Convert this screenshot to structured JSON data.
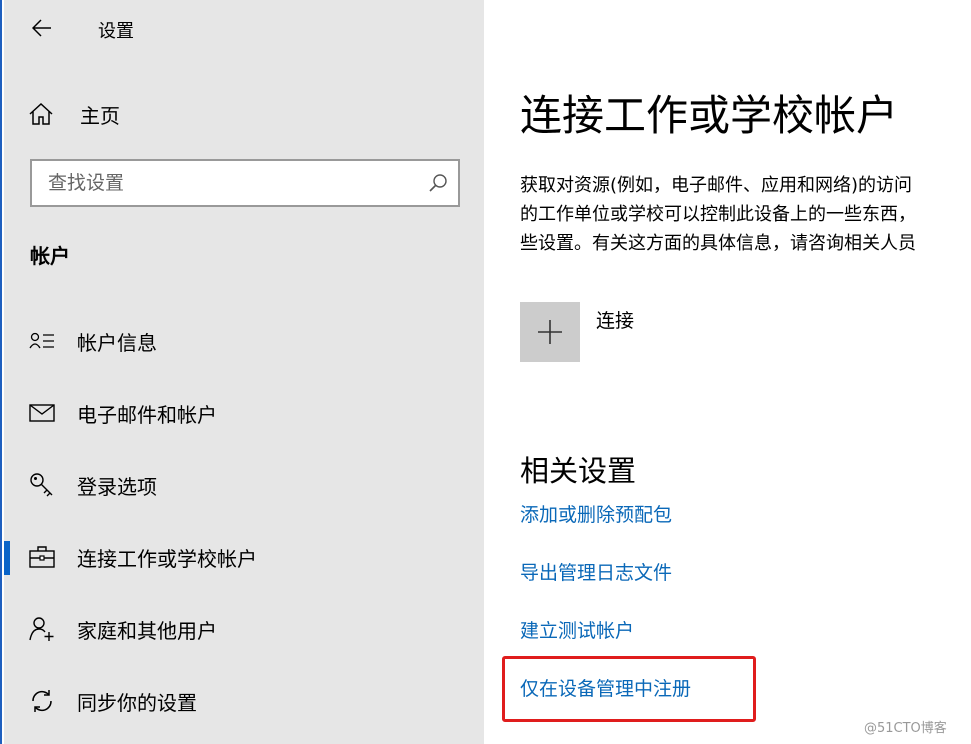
{
  "window": {
    "title": "设置"
  },
  "sidebar": {
    "home_label": "主页",
    "search_placeholder": "查找设置",
    "section_title": "帐户",
    "items": [
      {
        "label": "帐户信息",
        "icon": "account-info-icon"
      },
      {
        "label": "电子邮件和帐户",
        "icon": "mail-icon"
      },
      {
        "label": "登录选项",
        "icon": "key-icon"
      },
      {
        "label": "连接工作或学校帐户",
        "icon": "briefcase-icon",
        "selected": true
      },
      {
        "label": "家庭和其他用户",
        "icon": "add-person-icon"
      },
      {
        "label": "同步你的设置",
        "icon": "sync-icon"
      }
    ]
  },
  "main": {
    "title": "连接工作或学校帐户",
    "desc_lines": [
      "获取对资源(例如，电子邮件、应用和网络)的访问",
      "的工作单位或学校可以控制此设备上的一些东西，",
      "些设置。有关这方面的具体信息，请咨询相关人员"
    ],
    "connect_label": "连接",
    "related_title": "相关设置",
    "links": [
      "添加或删除预配包",
      "导出管理日志文件",
      "建立测试帐户",
      "仅在设备管理中注册"
    ]
  },
  "watermark": "@51CTO博客",
  "colors": {
    "accent": "#0a64c8",
    "link": "#0a68b8",
    "highlight": "#e01d1d",
    "sidebar_bg": "#e6e6e6"
  }
}
